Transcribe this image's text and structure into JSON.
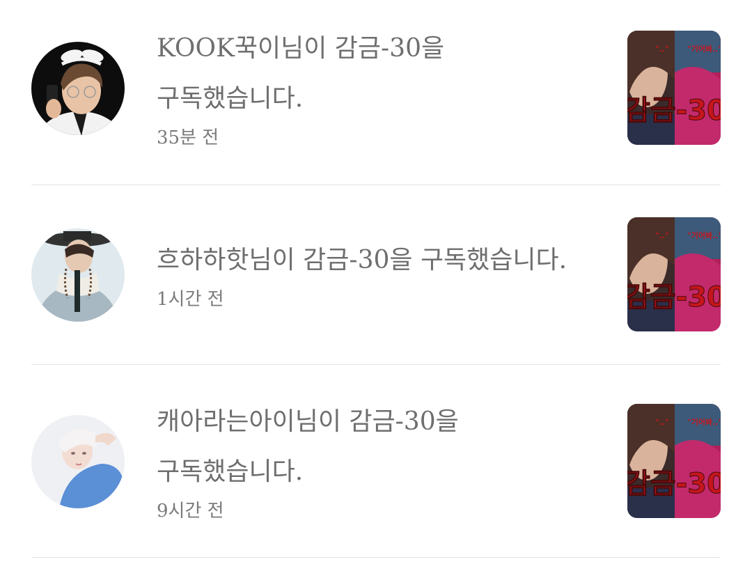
{
  "notifications": [
    {
      "message_line1": "KOOK꾹이님이 감금-30을",
      "message_line2": "구독했습니다.",
      "time": "35분 전",
      "avatar_icon": "user-avatar-photo",
      "thumbnail": {
        "title": "감금-30",
        "quote_left": "\"..\"",
        "quote_right": "\"기어봐..\""
      }
    },
    {
      "message_line1": "흐하하핫님이 감금-30을 구독했습니다.",
      "message_line2": "",
      "time": "1시간 전",
      "avatar_icon": "user-avatar-photo",
      "thumbnail": {
        "title": "감금-30",
        "quote_left": "\"..\"",
        "quote_right": "\"기어봐..\""
      }
    },
    {
      "message_line1": "캐아라는아이님이 감금-30을",
      "message_line2": "구독했습니다.",
      "time": "9시간 전",
      "avatar_icon": "user-avatar-photo",
      "thumbnail": {
        "title": "감금-30",
        "quote_left": "\"..\"",
        "quote_right": "\"기어봐..\""
      }
    }
  ],
  "colors": {
    "text": "#6e6e6e",
    "divider": "#e4e4e4",
    "thumb_title": "#c4161c"
  }
}
